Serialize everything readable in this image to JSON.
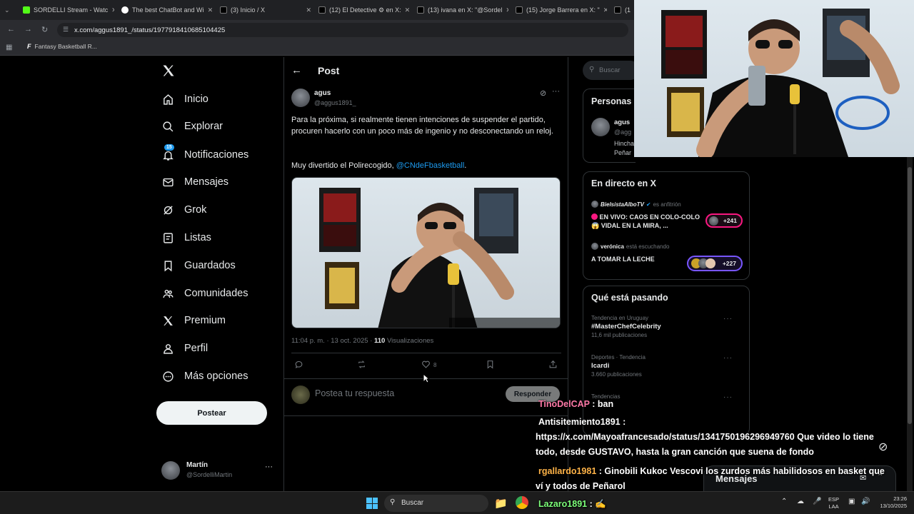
{
  "browser": {
    "tabs": [
      {
        "title": "SORDELLI Stream - Watc",
        "favicon": "kick-icon",
        "color": "#53fc18"
      },
      {
        "title": "The best ChatBot and Wi",
        "favicon": "chatbot-icon",
        "color": "#ffffff"
      },
      {
        "title": "(3) Inicio / X",
        "favicon": "x-icon",
        "color": "#ffffff"
      },
      {
        "title": "(12) El Detective ⚙ en X:",
        "favicon": "x-icon",
        "color": "#ffffff"
      },
      {
        "title": "(13) ivana en X: \"@Sordel",
        "favicon": "x-icon",
        "color": "#ffffff"
      },
      {
        "title": "(15) Jorge Barrera en X: \"",
        "favicon": "x-icon",
        "color": "#ffffff"
      },
      {
        "title": "(1",
        "favicon": "x-icon",
        "color": "#ffffff"
      }
    ],
    "url": "x.com/aggus1891_/status/1977918410685104425",
    "bookmark": "Fantasy Basketball R..."
  },
  "nav": {
    "items": [
      {
        "label": "Inicio",
        "icon": "home-icon"
      },
      {
        "label": "Explorar",
        "icon": "search-icon"
      },
      {
        "label": "Notificaciones",
        "icon": "bell-icon",
        "badge": "15"
      },
      {
        "label": "Mensajes",
        "icon": "mail-icon"
      },
      {
        "label": "Grok",
        "icon": "grok-icon"
      },
      {
        "label": "Listas",
        "icon": "list-icon"
      },
      {
        "label": "Guardados",
        "icon": "bookmark-icon"
      },
      {
        "label": "Comunidades",
        "icon": "communities-icon"
      },
      {
        "label": "Premium",
        "icon": "x-icon"
      },
      {
        "label": "Perfil",
        "icon": "person-icon"
      },
      {
        "label": "Más opciones",
        "icon": "more-icon"
      }
    ],
    "post_button": "Postear",
    "account": {
      "name": "Martín",
      "handle": "@SordelliMartin"
    }
  },
  "post": {
    "header": "Post",
    "author_name": "agus",
    "author_handle": "@aggus1891_",
    "text": "Para la próxima, si realmente tienen intenciones de suspender el partido, procuren hacerlo con un poco más de ingenio y no desconectando un reloj.",
    "text2_prefix": "Muy divertido el Polirecogido, ",
    "mention": "@CNdeFbasketball",
    "text2_suffix": ".",
    "meta_time": "11:04 p. m. · 13 oct. 2025 · ",
    "views": "110",
    "views_label": " Visualizaciones",
    "likes": "8",
    "reply_placeholder": "Postea tu respuesta",
    "reply_button": "Responder"
  },
  "right": {
    "search_placeholder": "Buscar",
    "people_title": "Personas",
    "person_name": "agus",
    "person_handle": "@agg",
    "person_bio_1": "Hincha",
    "person_bio_2": "Peñar",
    "live_title": "En directo en X",
    "live1_host": "BielsistaAlboTV",
    "live1_role": "es anfitrión",
    "live1_title": "EN VIVO: CAOS EN COLO-COLO 😱 VIDAL EN LA MIRA, ...",
    "live1_count": "+241",
    "live2_host": "verónica",
    "live2_role": "está escuchando",
    "live2_title": "A TOMAR LA LECHE",
    "live2_count": "+227",
    "trends_title": "Qué está pasando",
    "trends": [
      {
        "meta": "Tendencia en Uruguay",
        "name": "#MasterChefCelebrity",
        "count": "11,6 mil publicaciones"
      },
      {
        "meta": "Deportes · Tendencia",
        "name": "Icardi",
        "count": "3.660 publicaciones"
      },
      {
        "meta": "Tendencias",
        "name": "",
        "count": ""
      }
    ],
    "messages_label": "Mensajes"
  },
  "chat": [
    {
      "user": "TinoDelCAP",
      "user_color": "#ff7aa8",
      "msg": "ban"
    },
    {
      "user": "Antisitemiento1891",
      "user_color": "#ffffff",
      "msg": ""
    },
    {
      "user": "",
      "user_color": "#ffffff",
      "msg": "https://x.com/Mayoafrancesado/status/1341750196296949760 Que video lo tiene"
    },
    {
      "user": "",
      "user_color": "#ffffff",
      "msg": "todo, desde GUSTAVO, hasta la gran canción que suena de fondo"
    },
    {
      "user": "rgallardo1981",
      "user_color": "#ffb347",
      "msg": "Ginobili Kukoc Vescovi los zurdos más habilidosos en basket que"
    },
    {
      "user": "",
      "user_color": "#ffffff",
      "msg": "ví y todos de Peñarol"
    },
    {
      "user": "Lazaro1891",
      "user_color": "#7dff7a",
      "msg": ""
    }
  ],
  "taskbar": {
    "search": "Buscar",
    "lang_1": "ESP",
    "lang_2": "LAA",
    "time": "23:26",
    "date": "13/10/2025"
  },
  "colors": {
    "accent": "#1d9bf0",
    "badge": "#1d9bf0",
    "live_red": "#f91880",
    "space_purple": "#7856ff"
  }
}
